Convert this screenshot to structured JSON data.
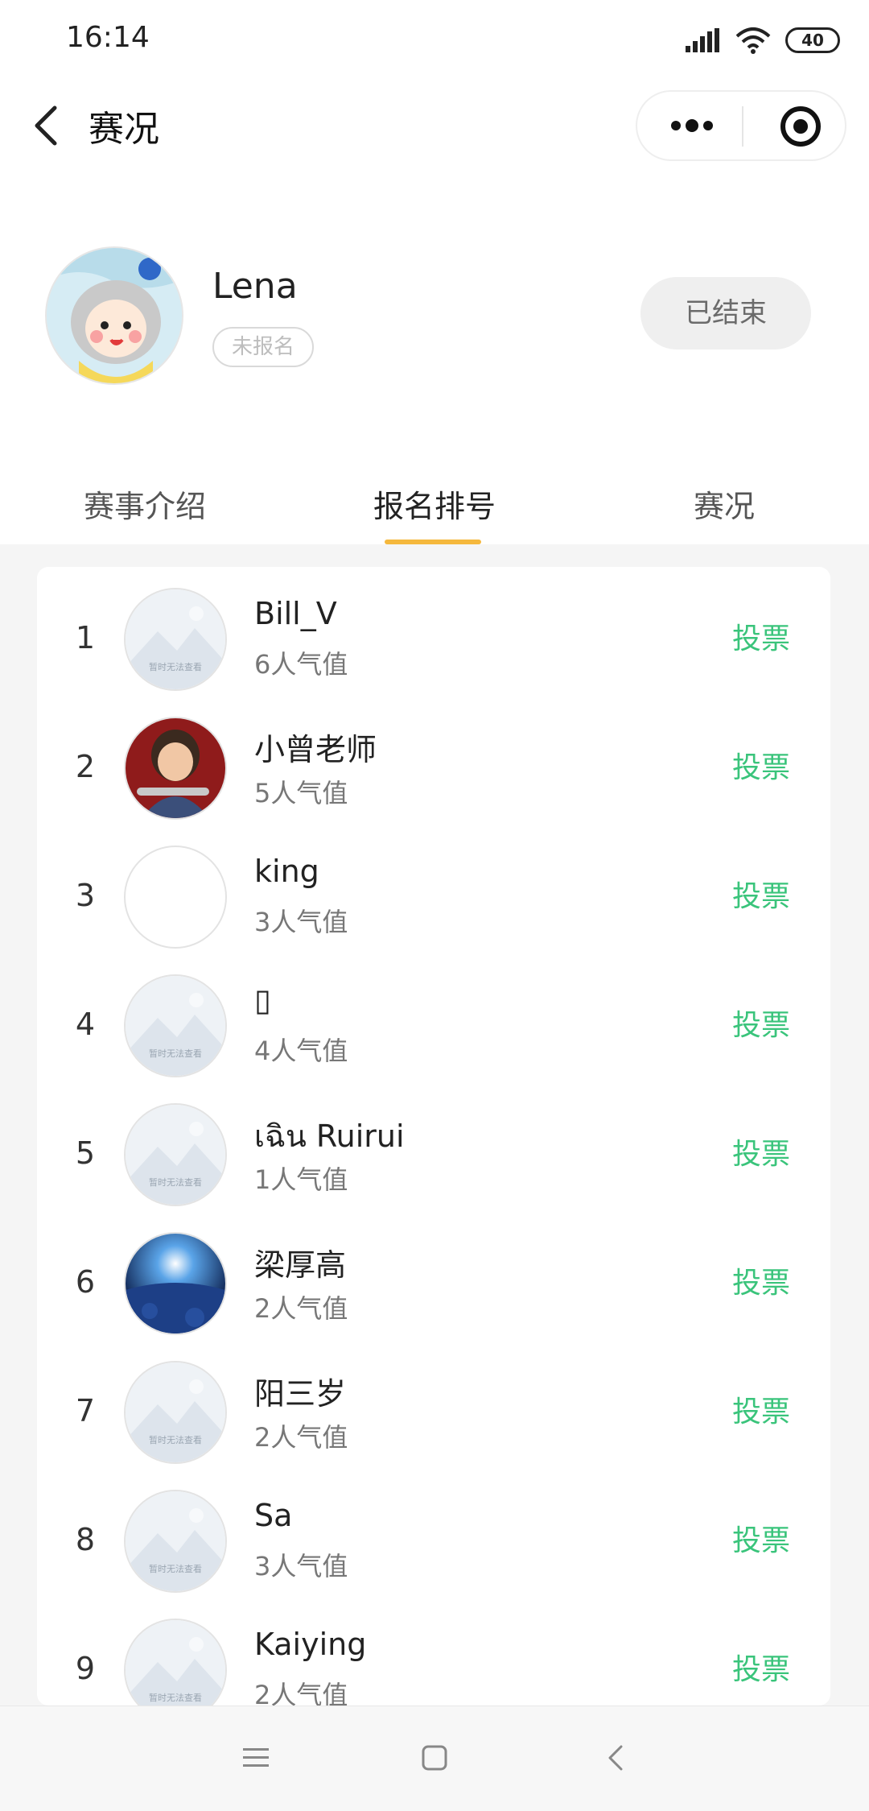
{
  "status": {
    "time": "16:14",
    "battery": "40"
  },
  "nav": {
    "title": "赛况"
  },
  "profile": {
    "name": "Lena",
    "status": "未报名",
    "ended_label": "已结束"
  },
  "tabs": [
    {
      "label": "赛事介绍"
    },
    {
      "label": "报名排号"
    },
    {
      "label": "赛况"
    }
  ],
  "vote_label": "投票",
  "vote_color": "#3ac47b",
  "tab_indicator_color": "#f5b83d",
  "placeholder_avatar_text": "暂时无法查看",
  "entries": [
    {
      "rank": "1",
      "name": "Bill_V",
      "votes": "6人气值",
      "avatar": "placeholder"
    },
    {
      "rank": "2",
      "name": "小曾老师",
      "votes": "5人气值",
      "avatar": "cartoon-guitar"
    },
    {
      "rank": "3",
      "name": "king",
      "votes": "3人气值",
      "avatar": "blank"
    },
    {
      "rank": "4",
      "name": "▯",
      "votes": "4人气值",
      "avatar": "placeholder"
    },
    {
      "rank": "5",
      "name": "เฉิน Ruirui",
      "votes": "1人气值",
      "avatar": "placeholder"
    },
    {
      "rank": "6",
      "name": "梁厚高",
      "votes": "2人气值",
      "avatar": "space-scene"
    },
    {
      "rank": "7",
      "name": "阳三岁",
      "votes": "2人气值",
      "avatar": "placeholder"
    },
    {
      "rank": "8",
      "name": "Sa",
      "votes": "3人气值",
      "avatar": "placeholder"
    },
    {
      "rank": "9",
      "name": "Kaiying",
      "votes": "2人气值",
      "avatar": "placeholder"
    }
  ]
}
